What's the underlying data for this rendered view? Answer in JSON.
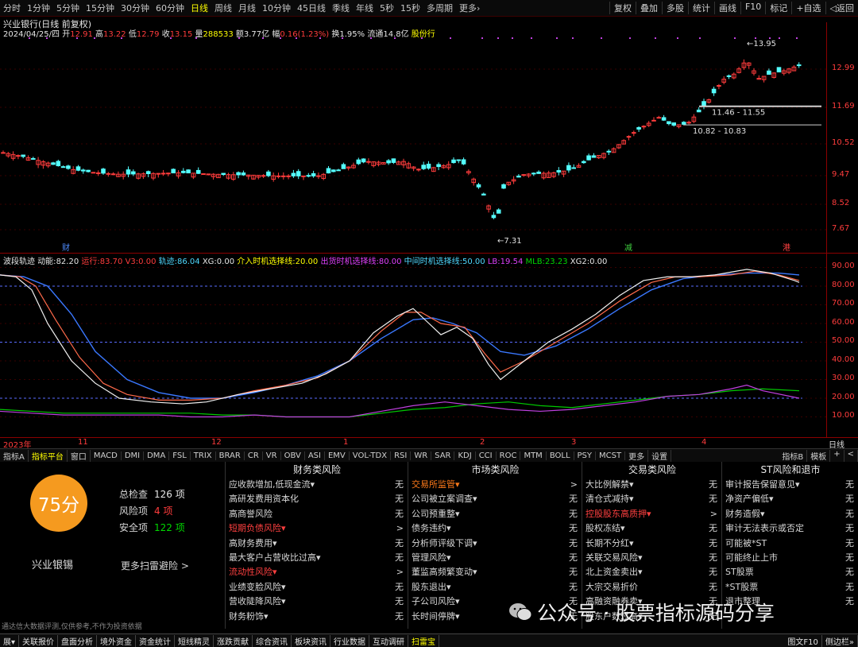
{
  "toolbar": {
    "periods": [
      "分时",
      "1分钟",
      "5分钟",
      "15分钟",
      "30分钟",
      "60分钟",
      "日线",
      "周线",
      "月线",
      "10分钟",
      "45日线",
      "季线",
      "年线",
      "5秒",
      "15秒",
      "多周期",
      "更多›"
    ],
    "active_period": "日线",
    "right_buttons": [
      "复权",
      "叠加",
      "多股",
      "统计",
      "画线",
      "F10",
      "标记",
      "+自选",
      "◁返回"
    ]
  },
  "stock": {
    "title": "兴业银行(日线 前复权)",
    "date": "2024/04/25/四",
    "open_label": "开",
    "open": "12.91",
    "high_label": "高",
    "high": "13.22",
    "low_label": "低",
    "low": "12.79",
    "close_label": "收",
    "close": "13.15",
    "volume_label": "量",
    "volume": "288533",
    "amount": "额3.77亿",
    "change_label": "幅",
    "change": "0.16(1.23%)",
    "turnover": "换1.95%",
    "float": "流通14.8亿",
    "sector": "股份行"
  },
  "kline": {
    "y_ticks": [
      "12.99",
      "11.69",
      "10.52",
      "9.47",
      "8.52",
      "7.67"
    ],
    "max_label": "13.95",
    "min_label": "7.31",
    "zone1_label": "11.46 - 11.55",
    "zone2_label": "10.82 - 10.83",
    "marker_fin": "财",
    "marker_reduce": "减",
    "marker_hk": "港",
    "colors": {
      "up": "#ff3c3c",
      "down": "#54ffff",
      "bg": "#000000"
    }
  },
  "indicator": {
    "name": "波段轨迹",
    "power_label": "动能:",
    "power": "82.20",
    "run_label": "运行:",
    "run": "83.70",
    "v3_label": "V3:",
    "v3": "0.00",
    "track_label": "轨迹:",
    "track": "86.04",
    "xg_label": "XG:",
    "xg": "0.00",
    "enter_label": "介入时机选择线:",
    "enter": "20.00",
    "exit_label": "出货时机选择线:",
    "exit": "80.00",
    "mid_label": "中间时机选择线:",
    "mid": "50.00",
    "lb_label": "LB:",
    "lb": "19.54",
    "mlb_label": "MLB:",
    "mlb": "23.23",
    "xg2_label": "XG2:",
    "xg2": "0.00",
    "y_ticks": [
      "90.00",
      "80.00",
      "70.00",
      "60.00",
      "50.00",
      "40.00",
      "30.00",
      "20.00",
      "10.00"
    ]
  },
  "xaxis": {
    "labels": [
      "2023年",
      "11",
      "12",
      "1",
      "2",
      "3",
      "4"
    ],
    "right_label": "日线"
  },
  "tabs": {
    "items": [
      "指标A",
      "指标平台",
      "窗口",
      "MACD",
      "DMI",
      "DMA",
      "FSL",
      "TRIX",
      "BRAR",
      "CR",
      "VR",
      "OBV",
      "ASI",
      "EMV",
      "VOL-TDX",
      "RSI",
      "WR",
      "SAR",
      "KDJ",
      "CCI",
      "ROC",
      "MTM",
      "BOLL",
      "PSY",
      "MCST",
      "更多",
      "设置"
    ],
    "active": "指标平台",
    "right_items": [
      "指标B",
      "模板",
      "+",
      "<"
    ]
  },
  "scan": {
    "score": "75分",
    "stock_name": "兴业银锡",
    "total_label": "总检查",
    "total": "126 项",
    "risk_label": "风险项",
    "risk": "4 项",
    "safe_label": "安全项",
    "safe": "122 项",
    "more_link": "更多扫雷避险 >",
    "disclaimer": "通达信大数据评测,仅供参考,不作为投资依据",
    "columns": [
      {
        "title": "财务类风险",
        "rows": [
          {
            "name": "应收款增加,低现金流▾",
            "value": "无"
          },
          {
            "name": "高研发费用资本化",
            "value": "无"
          },
          {
            "name": "高商誉风险",
            "value": "无"
          },
          {
            "name": "短期负债风险▾",
            "value": ">",
            "hl": "red"
          },
          {
            "name": "高财务费用▾",
            "value": "无"
          },
          {
            "name": "最大客户占营收比过高▾",
            "value": "无"
          },
          {
            "name": "流动性风险▾",
            "value": ">",
            "hl": "red"
          },
          {
            "name": "业绩变脸风险▾",
            "value": "无"
          },
          {
            "name": "营收陡降风险▾",
            "value": "无"
          },
          {
            "name": "财务粉饰▾",
            "value": "无"
          }
        ]
      },
      {
        "title": "市场类风险",
        "rows": [
          {
            "name": "交易所监管▾",
            "value": ">",
            "hl": "orange"
          },
          {
            "name": "公司被立案调查▾",
            "value": "无"
          },
          {
            "name": "公司预重整▾",
            "value": "无"
          },
          {
            "name": "债务违约▾",
            "value": "无"
          },
          {
            "name": "分析师评级下调▾",
            "value": "无"
          },
          {
            "name": "管理风险▾",
            "value": "无"
          },
          {
            "name": "董监高频繁变动▾",
            "value": "无"
          },
          {
            "name": "股东退出▾",
            "value": "无"
          },
          {
            "name": "子公司风险▾",
            "value": "无"
          },
          {
            "name": "长时间停牌▾",
            "value": "无"
          }
        ]
      },
      {
        "title": "交易类风险",
        "rows": [
          {
            "name": "大比例解禁▾",
            "value": "无"
          },
          {
            "name": "清仓式减持▾",
            "value": "无"
          },
          {
            "name": "控股股东高质押▾",
            "value": ">",
            "hl": "red"
          },
          {
            "name": "股权冻结▾",
            "value": "无"
          },
          {
            "name": "长期不分红▾",
            "value": "无"
          },
          {
            "name": "关联交易风险▾",
            "value": "无"
          },
          {
            "name": "北上资金卖出▾",
            "value": "无"
          },
          {
            "name": "大宗交易折价",
            "value": "无"
          },
          {
            "name": "高融资融券卖▾",
            "value": "无"
          },
          {
            "name": "股东户数过高▾",
            "value": "无"
          }
        ]
      },
      {
        "title": "ST风险和退市",
        "rows": [
          {
            "name": "审计报告保留意见▾",
            "value": "无"
          },
          {
            "name": "净资产偏低▾",
            "value": "无"
          },
          {
            "name": "财务造假▾",
            "value": "无"
          },
          {
            "name": "审计无法表示或否定",
            "value": "无"
          },
          {
            "name": "可能被*ST",
            "value": "无"
          },
          {
            "name": "可能终止上市",
            "value": "无"
          },
          {
            "name": "ST股票",
            "value": "无"
          },
          {
            "name": "*ST股票",
            "value": "无"
          },
          {
            "name": "退市整理",
            "value": "无"
          },
          {
            "name": "",
            "value": ""
          }
        ]
      }
    ]
  },
  "watermark": "公众号 · 股票指标源码分享",
  "bottombar": {
    "items": [
      "展▾",
      "关联报价",
      "盘面分析",
      "境外资金",
      "资金统计",
      "短线精灵",
      "涨跌贡献",
      "综合资讯",
      "板块资讯",
      "行业数据",
      "互动调研",
      "扫雷宝"
    ],
    "active": "扫雷宝",
    "right_items": [
      "图文F10",
      "侧边栏»"
    ]
  }
}
